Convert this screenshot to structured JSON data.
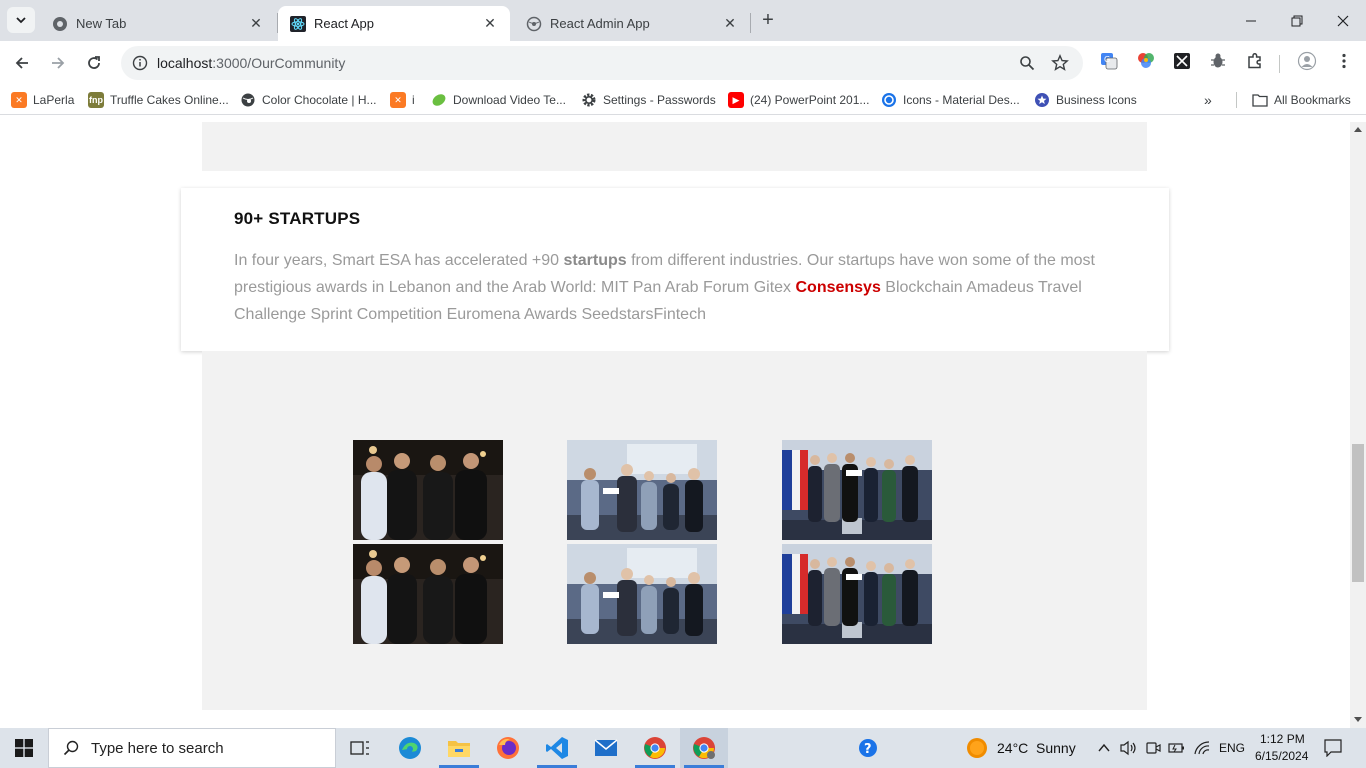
{
  "browser": {
    "tabs": [
      {
        "title": "New Tab",
        "active": false
      },
      {
        "title": "React App",
        "active": true
      },
      {
        "title": "React Admin App",
        "active": false
      }
    ],
    "url_host": "localhost",
    "url_path": ":3000/OurCommunity",
    "bookmarks": [
      {
        "label": "LaPerla",
        "icon": "xampp-icon"
      },
      {
        "label": "Truffle Cakes Online...",
        "icon": "fnp-icon"
      },
      {
        "label": "Color Chocolate | H...",
        "icon": "globe-icon"
      },
      {
        "label": "i",
        "icon": "xampp-icon"
      },
      {
        "label": "Download Video Te...",
        "icon": "leaf-icon"
      },
      {
        "label": "Settings - Passwords",
        "icon": "gear-icon"
      },
      {
        "label": "(24) PowerPoint 201...",
        "icon": "youtube-icon"
      },
      {
        "label": "Icons - Material Des...",
        "icon": "material-icon"
      },
      {
        "label": "Business Icons",
        "icon": "star-badge-icon"
      }
    ],
    "all_bookmarks": "All Bookmarks"
  },
  "page": {
    "section_title": "90+ STARTUPS",
    "desc_part1": "In four years, Smart ESA has accelerated +90 ",
    "desc_bold": "startups",
    "desc_part2": " from different industries. Our startups have won some of the most prestigious awards in Lebanon and the Arab World: MIT Pan Arab Forum Gitex ",
    "desc_red": "Consensys",
    "desc_part3": " Blockchain Amadeus Travel Challenge Sprint Competition Euromena Awards SeedstarsFintech",
    "photos": [
      {
        "kind": "group-night"
      },
      {
        "kind": "award-stage"
      },
      {
        "kind": "award-flags"
      },
      {
        "kind": "group-night"
      },
      {
        "kind": "award-stage"
      },
      {
        "kind": "award-flags"
      }
    ]
  },
  "taskbar": {
    "search_placeholder": "Type here to search",
    "weather_temp": "24°C",
    "weather_cond": "Sunny",
    "lang": "ENG",
    "time": "1:12 PM",
    "date": "6/15/2024"
  },
  "colors": {
    "accent_red": "#cc0000",
    "gray_bg": "#f2f2f2",
    "text_muted": "#9a9a9a"
  }
}
